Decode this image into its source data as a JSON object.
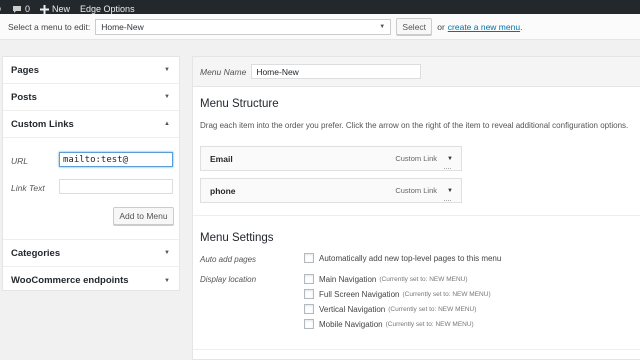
{
  "admin_bar": {
    "comments_count": "0",
    "new_label": "New",
    "edge_options_label": "Edge Options"
  },
  "select_bar": {
    "prompt": "Select a menu to edit:",
    "selected_menu": "Home-New",
    "select_button": "Select",
    "or_text": "or",
    "create_link": "create a new menu",
    "period": "."
  },
  "left_panel": {
    "sections": [
      {
        "label": "Pages",
        "expanded": false
      },
      {
        "label": "Posts",
        "expanded": false
      },
      {
        "label": "Custom Links",
        "expanded": true
      },
      {
        "label": "Categories",
        "expanded": false
      },
      {
        "label": "WooCommerce endpoints",
        "expanded": false
      }
    ],
    "custom_links": {
      "url_label": "URL",
      "url_value": "mailto:test@",
      "link_text_label": "Link Text",
      "link_text_value": "",
      "add_button": "Add to Menu"
    }
  },
  "right_panel": {
    "menu_name_label": "Menu Name",
    "menu_name_value": "Home-New",
    "structure_title": "Menu Structure",
    "structure_instructions": "Drag each item into the order you prefer. Click the arrow on the right of the item to reveal additional configuration options.",
    "menu_items": [
      {
        "title": "Email",
        "type": "Custom Link"
      },
      {
        "title": "phone",
        "type": "Custom Link"
      }
    ],
    "settings_title": "Menu Settings",
    "auto_add_label": "Auto add pages",
    "auto_add_text": "Automatically add new top-level pages to this menu",
    "display_location_label": "Display location",
    "locations": [
      {
        "name": "Main Navigation",
        "note": "(Currently set to: NEW MENU)"
      },
      {
        "name": "Full Screen Navigation",
        "note": "(Currently set to: NEW MENU)"
      },
      {
        "name": "Vertical Navigation",
        "note": "(Currently set to: NEW MENU)"
      },
      {
        "name": "Mobile Navigation",
        "note": "(Currently set to: NEW MENU)"
      }
    ]
  },
  "colors": {
    "admin_bar_bg": "#23282d",
    "link_blue": "#0073aa",
    "focus_blue": "#5b9dd9"
  }
}
